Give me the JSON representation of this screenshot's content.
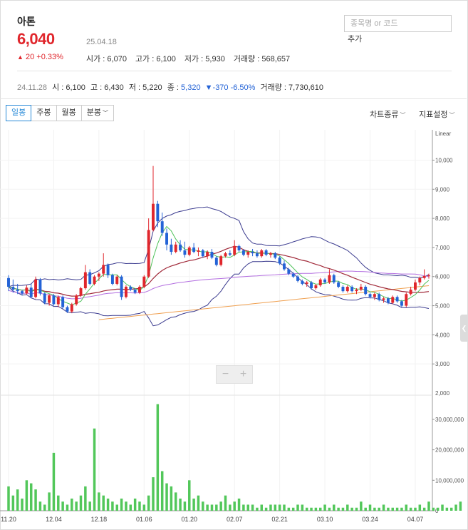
{
  "stock": {
    "name": "아톤",
    "price": "6,040",
    "date": "25.04.18",
    "change_arrow": "▲",
    "change_text": "20 +0.33%",
    "open": "시가 : 6,070",
    "high": "고가 : 6,100",
    "low": "저가 : 5,930",
    "volume": "거래량 : 568,657"
  },
  "search": {
    "placeholder": "종목명 or 코드",
    "add_label": "추가"
  },
  "hover": {
    "date": "24.11.28",
    "open": "시 : 6,100",
    "high": "고 : 6,430",
    "low": "저 : 5,220",
    "close_label": "종 : ",
    "close_value": "5,320",
    "change": "▼-370 -6.50%",
    "volume": "거래량 : 7,730,610"
  },
  "tabs": [
    {
      "label": "일봉",
      "active": true
    },
    {
      "label": "주봉",
      "active": false
    },
    {
      "label": "월봉",
      "active": false
    },
    {
      "label": "분봉",
      "active": false,
      "dropdown": true
    }
  ],
  "menu": {
    "chart_type": "차트종류",
    "indicator": "지표설정"
  },
  "zoom": {
    "minus": "−",
    "plus": "+"
  },
  "icons": {
    "dropdown": "chevron-down-icon",
    "side_handle": "chevron-left-icon"
  },
  "colors": {
    "up": "#e0262c",
    "down": "#2463d6",
    "volume": "#52c75a",
    "ma5": "#4ec25a",
    "ma20": "#a02838",
    "ma60": "#b36ee0",
    "ma120": "#f0a050",
    "band": "#3b3b8f"
  },
  "chart_data": {
    "type": "candlestick",
    "scale_label": "Linear",
    "price_axis": {
      "ticks": [
        3000,
        4000,
        5000,
        6000,
        7000,
        8000,
        9000,
        10000
      ],
      "tick_labels": [
        "3,000",
        "4,000",
        "5,000",
        "6,000",
        "7,000",
        "8,000",
        "9,000",
        "10,000"
      ],
      "ylim": [
        2000,
        10600
      ]
    },
    "volume_axis": {
      "ticks": [
        0,
        10000000,
        20000000,
        30000000
      ],
      "tick_labels": [
        "0",
        "10,000,000",
        "20,000,000",
        "30,000,000"
      ],
      "ylim": [
        0,
        37000000
      ]
    },
    "x_labels": [
      "11.20",
      "12.04",
      "12.18",
      "01.06",
      "01.20",
      "02.07",
      "02.21",
      "03.10",
      "03.24",
      "04.07"
    ],
    "x_label_index": [
      0,
      10,
      20,
      30,
      40,
      50,
      60,
      70,
      80,
      90
    ],
    "candles": [
      {
        "o": 5950,
        "h": 6050,
        "l": 5500,
        "c": 5650
      },
      {
        "o": 5650,
        "h": 5900,
        "l": 5450,
        "c": 5550
      },
      {
        "o": 5550,
        "h": 5750,
        "l": 5400,
        "c": 5500
      },
      {
        "o": 5500,
        "h": 5550,
        "l": 5350,
        "c": 5420
      },
      {
        "o": 5420,
        "h": 5700,
        "l": 5380,
        "c": 5620
      },
      {
        "o": 5620,
        "h": 5750,
        "l": 5250,
        "c": 5300
      },
      {
        "o": 5300,
        "h": 6000,
        "l": 5250,
        "c": 5900
      },
      {
        "o": 5900,
        "h": 5950,
        "l": 5350,
        "c": 5420
      },
      {
        "o": 5420,
        "h": 5450,
        "l": 5050,
        "c": 5100
      },
      {
        "o": 5100,
        "h": 5400,
        "l": 5000,
        "c": 5350
      },
      {
        "o": 5350,
        "h": 5400,
        "l": 5000,
        "c": 5050
      },
      {
        "o": 5050,
        "h": 5350,
        "l": 4950,
        "c": 5300
      },
      {
        "o": 5300,
        "h": 5350,
        "l": 4900,
        "c": 4950
      },
      {
        "o": 4950,
        "h": 5000,
        "l": 4750,
        "c": 4800
      },
      {
        "o": 4800,
        "h": 5100,
        "l": 4750,
        "c": 5050
      },
      {
        "o": 5050,
        "h": 5400,
        "l": 5000,
        "c": 5350
      },
      {
        "o": 5350,
        "h": 5650,
        "l": 5300,
        "c": 5600
      },
      {
        "o": 5600,
        "h": 6400,
        "l": 5550,
        "c": 6150
      },
      {
        "o": 6150,
        "h": 6250,
        "l": 5700,
        "c": 5750
      },
      {
        "o": 5750,
        "h": 6050,
        "l": 5700,
        "c": 6000
      },
      {
        "o": 6000,
        "h": 6150,
        "l": 5850,
        "c": 6100
      },
      {
        "o": 6100,
        "h": 6800,
        "l": 6000,
        "c": 6400
      },
      {
        "o": 6400,
        "h": 6450,
        "l": 5950,
        "c": 6050
      },
      {
        "o": 6050,
        "h": 6100,
        "l": 5700,
        "c": 5750
      },
      {
        "o": 5750,
        "h": 6050,
        "l": 5700,
        "c": 6000
      },
      {
        "o": 6000,
        "h": 6050,
        "l": 5200,
        "c": 5300
      },
      {
        "o": 5300,
        "h": 5700,
        "l": 5250,
        "c": 5650
      },
      {
        "o": 5650,
        "h": 5700,
        "l": 5500,
        "c": 5550
      },
      {
        "o": 5550,
        "h": 5600,
        "l": 5400,
        "c": 5450
      },
      {
        "o": 5450,
        "h": 5700,
        "l": 5400,
        "c": 5650
      },
      {
        "o": 5650,
        "h": 6050,
        "l": 5600,
        "c": 6000
      },
      {
        "o": 6000,
        "h": 8000,
        "l": 5950,
        "c": 7600
      },
      {
        "o": 7600,
        "h": 9800,
        "l": 7550,
        "c": 8500
      },
      {
        "o": 8500,
        "h": 8600,
        "l": 7700,
        "c": 7900
      },
      {
        "o": 7900,
        "h": 8200,
        "l": 7400,
        "c": 7500
      },
      {
        "o": 7500,
        "h": 7650,
        "l": 6900,
        "c": 7100
      },
      {
        "o": 7100,
        "h": 7300,
        "l": 6750,
        "c": 6850
      },
      {
        "o": 6850,
        "h": 7200,
        "l": 6800,
        "c": 7100
      },
      {
        "o": 7100,
        "h": 7250,
        "l": 6850,
        "c": 6900
      },
      {
        "o": 6900,
        "h": 7200,
        "l": 6650,
        "c": 6750
      },
      {
        "o": 6750,
        "h": 7050,
        "l": 6700,
        "c": 7000
      },
      {
        "o": 7000,
        "h": 7150,
        "l": 6800,
        "c": 6850
      },
      {
        "o": 6850,
        "h": 7000,
        "l": 6700,
        "c": 6900
      },
      {
        "o": 6900,
        "h": 6950,
        "l": 6650,
        "c": 6700
      },
      {
        "o": 6700,
        "h": 6900,
        "l": 6600,
        "c": 6850
      },
      {
        "o": 6850,
        "h": 6950,
        "l": 6600,
        "c": 6650
      },
      {
        "o": 6650,
        "h": 6700,
        "l": 6350,
        "c": 6400
      },
      {
        "o": 6400,
        "h": 6750,
        "l": 6350,
        "c": 6700
      },
      {
        "o": 6700,
        "h": 6850,
        "l": 6650,
        "c": 6800
      },
      {
        "o": 6800,
        "h": 6900,
        "l": 6700,
        "c": 6750
      },
      {
        "o": 6750,
        "h": 7250,
        "l": 6700,
        "c": 7050
      },
      {
        "o": 7050,
        "h": 7100,
        "l": 6850,
        "c": 6900
      },
      {
        "o": 6900,
        "h": 6950,
        "l": 6700,
        "c": 6750
      },
      {
        "o": 6750,
        "h": 6900,
        "l": 6650,
        "c": 6850
      },
      {
        "o": 6850,
        "h": 6950,
        "l": 6700,
        "c": 6800
      },
      {
        "o": 6800,
        "h": 6900,
        "l": 6650,
        "c": 6700
      },
      {
        "o": 6700,
        "h": 6950,
        "l": 6650,
        "c": 6900
      },
      {
        "o": 6900,
        "h": 6950,
        "l": 6700,
        "c": 6750
      },
      {
        "o": 6750,
        "h": 6850,
        "l": 6650,
        "c": 6800
      },
      {
        "o": 6800,
        "h": 6850,
        "l": 6600,
        "c": 6650
      },
      {
        "o": 6650,
        "h": 6700,
        "l": 6400,
        "c": 6450
      },
      {
        "o": 6450,
        "h": 6550,
        "l": 6200,
        "c": 6250
      },
      {
        "o": 6250,
        "h": 6300,
        "l": 6050,
        "c": 6100
      },
      {
        "o": 6100,
        "h": 6150,
        "l": 5950,
        "c": 6000
      },
      {
        "o": 6000,
        "h": 6050,
        "l": 5800,
        "c": 5850
      },
      {
        "o": 5850,
        "h": 5900,
        "l": 5700,
        "c": 5750
      },
      {
        "o": 5750,
        "h": 5850,
        "l": 5650,
        "c": 5800
      },
      {
        "o": 5800,
        "h": 5850,
        "l": 5550,
        "c": 5600
      },
      {
        "o": 5600,
        "h": 5750,
        "l": 5550,
        "c": 5700
      },
      {
        "o": 5700,
        "h": 5950,
        "l": 5650,
        "c": 5900
      },
      {
        "o": 5900,
        "h": 5950,
        "l": 5750,
        "c": 5800
      },
      {
        "o": 5800,
        "h": 6250,
        "l": 5750,
        "c": 6050
      },
      {
        "o": 6050,
        "h": 6100,
        "l": 5750,
        "c": 5800
      },
      {
        "o": 5800,
        "h": 5850,
        "l": 5600,
        "c": 5650
      },
      {
        "o": 5650,
        "h": 5700,
        "l": 5450,
        "c": 5500
      },
      {
        "o": 5500,
        "h": 5700,
        "l": 5450,
        "c": 5650
      },
      {
        "o": 5650,
        "h": 5700,
        "l": 5450,
        "c": 5500
      },
      {
        "o": 5500,
        "h": 5600,
        "l": 5400,
        "c": 5550
      },
      {
        "o": 5550,
        "h": 5750,
        "l": 5500,
        "c": 5650
      },
      {
        "o": 5650,
        "h": 5700,
        "l": 5350,
        "c": 5400
      },
      {
        "o": 5400,
        "h": 5450,
        "l": 5250,
        "c": 5300
      },
      {
        "o": 5300,
        "h": 5450,
        "l": 5200,
        "c": 5400
      },
      {
        "o": 5400,
        "h": 5450,
        "l": 5150,
        "c": 5200
      },
      {
        "o": 5200,
        "h": 5300,
        "l": 5100,
        "c": 5250
      },
      {
        "o": 5250,
        "h": 5300,
        "l": 5050,
        "c": 5100
      },
      {
        "o": 5100,
        "h": 5350,
        "l": 5050,
        "c": 5300
      },
      {
        "o": 5300,
        "h": 5350,
        "l": 5100,
        "c": 5150
      },
      {
        "o": 5150,
        "h": 5200,
        "l": 4950,
        "c": 5000
      },
      {
        "o": 5000,
        "h": 5450,
        "l": 4950,
        "c": 5400
      },
      {
        "o": 5400,
        "h": 5650,
        "l": 5350,
        "c": 5550
      },
      {
        "o": 5550,
        "h": 5900,
        "l": 5500,
        "c": 5800
      },
      {
        "o": 5800,
        "h": 6000,
        "l": 5700,
        "c": 5950
      },
      {
        "o": 5950,
        "h": 6250,
        "l": 5900,
        "c": 6020
      },
      {
        "o": 6020,
        "h": 6100,
        "l": 5930,
        "c": 6040
      }
    ],
    "volume_m": [
      8,
      5,
      7,
      4,
      10,
      9,
      7,
      3,
      2,
      6,
      19,
      5,
      3,
      2,
      4,
      3,
      5,
      8,
      3,
      27,
      6,
      5,
      4,
      3,
      2,
      4,
      3,
      2,
      4,
      3,
      2,
      5,
      11,
      35,
      13,
      9,
      8,
      6,
      4,
      3,
      10,
      4,
      5,
      3,
      2,
      2,
      2,
      3,
      5,
      2,
      3,
      4,
      2,
      2,
      2,
      1,
      2,
      1,
      2,
      2,
      2,
      2,
      1,
      1,
      2,
      2,
      1,
      1,
      1,
      1,
      2,
      1,
      2,
      1,
      1,
      2,
      1,
      1,
      3,
      1,
      2,
      1,
      1,
      2,
      1,
      1,
      1,
      1,
      2,
      1,
      1,
      2,
      1,
      3,
      1,
      1,
      2,
      1,
      1,
      2,
      3
    ]
  }
}
